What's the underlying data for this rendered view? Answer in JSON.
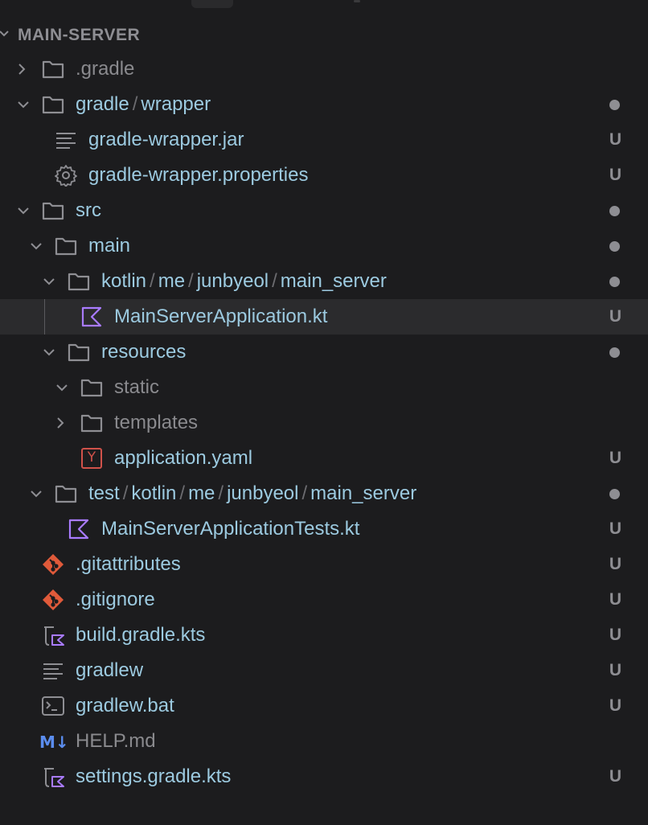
{
  "section": {
    "title": "MAIN-SERVER"
  },
  "colors": {
    "background": "#1c1c1e",
    "selected_row": "#2b2b2d",
    "file_label": "#9ccae0",
    "muted_label": "#8a8a8e",
    "status": "#8e8e93",
    "kotlin_icon": "#a97bff",
    "git_icon": "#e05a3a",
    "yaml_icon": "#d0524a",
    "markdown_icon": "#5b8def"
  },
  "rows": [
    {
      "label": ".gradle",
      "icon": "folder-icon",
      "chevron": "collapsed",
      "status": "",
      "muted": true
    },
    {
      "segments": [
        "gradle",
        "wrapper"
      ],
      "icon": "folder-icon",
      "chevron": "expanded",
      "status": "dot"
    },
    {
      "label": "gradle-wrapper.jar",
      "icon": "lines-icon",
      "status": "U"
    },
    {
      "label": "gradle-wrapper.properties",
      "icon": "gear-icon",
      "status": "U"
    },
    {
      "label": "src",
      "icon": "folder-icon",
      "chevron": "expanded",
      "status": "dot"
    },
    {
      "label": "main",
      "icon": "folder-icon",
      "chevron": "expanded",
      "status": "dot"
    },
    {
      "segments": [
        "kotlin",
        "me",
        "junbyeol",
        "main_server"
      ],
      "icon": "folder-icon",
      "chevron": "expanded",
      "status": "dot"
    },
    {
      "label": "MainServerApplication.kt",
      "icon": "kotlin-icon",
      "status": "U",
      "selected": true
    },
    {
      "label": "resources",
      "icon": "folder-icon",
      "chevron": "expanded",
      "status": "dot"
    },
    {
      "label": "static",
      "icon": "folder-icon",
      "chevron": "expanded",
      "status": "",
      "muted": true
    },
    {
      "label": "templates",
      "icon": "folder-icon",
      "chevron": "collapsed",
      "status": "",
      "muted": true
    },
    {
      "label": "application.yaml",
      "icon": "yaml-icon",
      "status": "U",
      "yaml_letter": "Y"
    },
    {
      "segments": [
        "test",
        "kotlin",
        "me",
        "junbyeol",
        "main_server"
      ],
      "icon": "folder-icon",
      "chevron": "expanded",
      "status": "dot"
    },
    {
      "label": "MainServerApplicationTests.kt",
      "icon": "kotlin-icon",
      "status": "U"
    },
    {
      "label": ".gitattributes",
      "icon": "git-icon",
      "status": "U"
    },
    {
      "label": ".gitignore",
      "icon": "git-icon",
      "status": "U"
    },
    {
      "label": "build.gradle.kts",
      "icon": "gradle-kts-icon",
      "status": "U"
    },
    {
      "label": "gradlew",
      "icon": "lines-icon",
      "status": "U"
    },
    {
      "label": "gradlew.bat",
      "icon": "terminal-icon",
      "status": "U"
    },
    {
      "label": "HELP.md",
      "icon": "markdown-icon",
      "status": "",
      "muted": true,
      "md_text": "M↓"
    },
    {
      "label": "settings.gradle.kts",
      "icon": "gradle-kts-icon",
      "status": "U"
    }
  ]
}
